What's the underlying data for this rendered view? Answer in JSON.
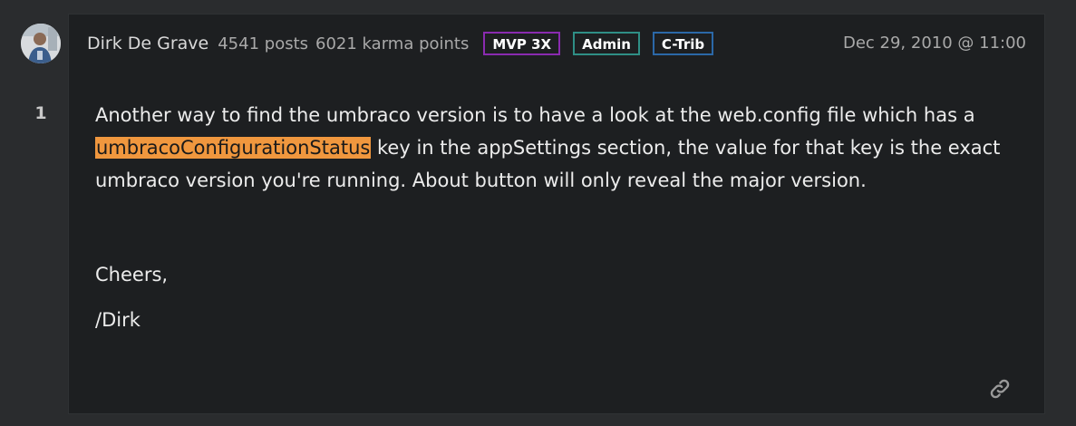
{
  "post": {
    "author": "Dirk De Grave",
    "posts": "4541 posts",
    "karma": "6021 karma points",
    "badges": [
      "MVP 3X",
      "Admin",
      "C-Trib"
    ],
    "date": "Dec 29, 2010 @ 11:00",
    "vote_count": "1",
    "body": {
      "line1_prefix": "Another way to find the umbraco version is to have a look at the web.config file which has a ",
      "highlight": "umbracoConfigurationStatus",
      "line1_suffix": " key in the appSettings section, the value for that key is the exact umbraco version you're running. About button will only reveal the major version.",
      "cheers": "Cheers,",
      "signature": "/Dirk"
    }
  },
  "icons": {
    "avatar": "user-avatar",
    "permalink": "link-icon"
  },
  "colors": {
    "background": "#2a2c2e",
    "card": "#1d1f21",
    "highlight": "#f0973e",
    "badge_mvp": "#8a2bb0",
    "badge_admin": "#2f8f86",
    "badge_ctrib": "#2b68a8"
  }
}
